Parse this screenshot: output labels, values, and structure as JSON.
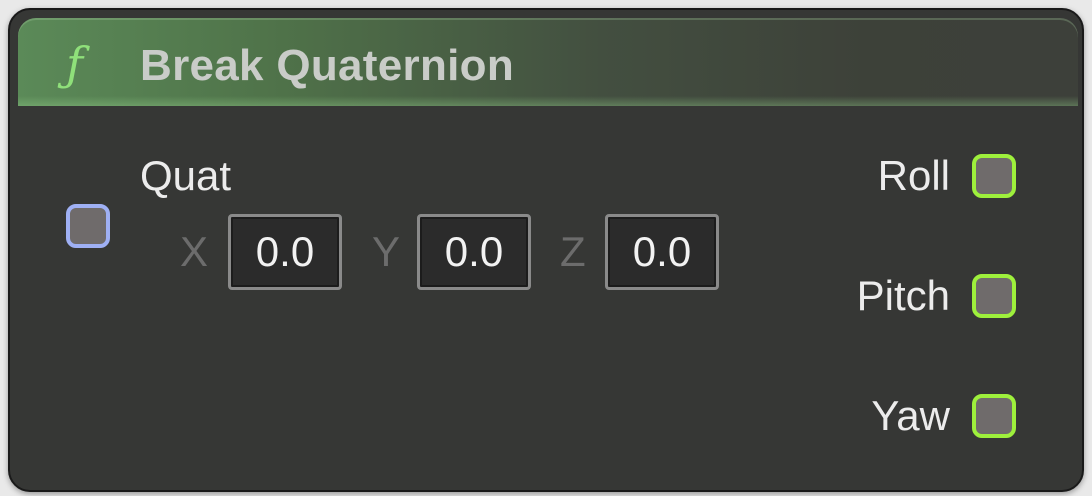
{
  "node": {
    "title": "Break Quaternion",
    "function_icon": "ƒ"
  },
  "inputs": {
    "quat": {
      "label": "Quat",
      "x_axis": "X",
      "x_value": "0.0",
      "y_axis": "Y",
      "y_value": "0.0",
      "z_axis": "Z",
      "z_value": "0.0"
    }
  },
  "outputs": [
    {
      "label": "Roll"
    },
    {
      "label": "Pitch"
    },
    {
      "label": "Yaw"
    }
  ],
  "colors": {
    "input_pin_border": "#9fb0f4",
    "output_pin_border": "#9ef03c",
    "header_accent": "#5b8a58",
    "function_icon": "#8fe07a"
  }
}
